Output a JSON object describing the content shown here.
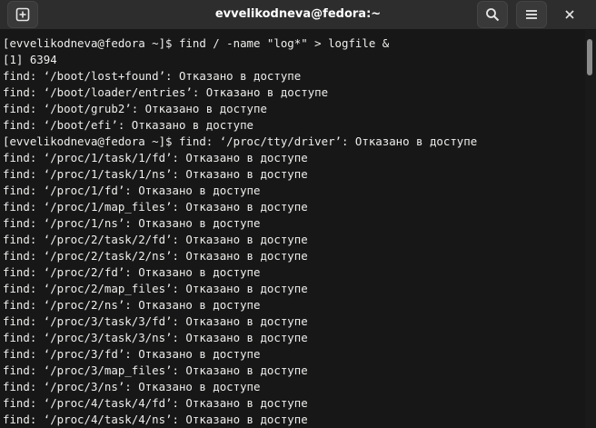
{
  "window": {
    "title": "evvelikodneva@fedora:~"
  },
  "toolbar": {
    "new_tab_icon": "new-tab-icon",
    "search_icon": "search-icon",
    "menu_icon": "hamburger-menu-icon",
    "close_icon": "close-icon"
  },
  "colors": {
    "titlebar_bg": "#2d2d2d",
    "terminal_bg": "#171717",
    "text": "#eeeeec"
  },
  "terminal": {
    "lines": [
      "[evvelikodneva@fedora ~]$ find / -name \"log*\" > logfile &",
      "[1] 6394",
      "find: ‘/boot/lost+found’: Отказано в доступе",
      "find: ‘/boot/loader/entries’: Отказано в доступе",
      "find: ‘/boot/grub2’: Отказано в доступе",
      "find: ‘/boot/efi’: Отказано в доступе",
      "[evvelikodneva@fedora ~]$ find: ‘/proc/tty/driver’: Отказано в доступе",
      "find: ‘/proc/1/task/1/fd’: Отказано в доступе",
      "find: ‘/proc/1/task/1/ns’: Отказано в доступе",
      "find: ‘/proc/1/fd’: Отказано в доступе",
      "find: ‘/proc/1/map_files’: Отказано в доступе",
      "find: ‘/proc/1/ns’: Отказано в доступе",
      "find: ‘/proc/2/task/2/fd’: Отказано в доступе",
      "find: ‘/proc/2/task/2/ns’: Отказано в доступе",
      "find: ‘/proc/2/fd’: Отказано в доступе",
      "find: ‘/proc/2/map_files’: Отказано в доступе",
      "find: ‘/proc/2/ns’: Отказано в доступе",
      "find: ‘/proc/3/task/3/fd’: Отказано в доступе",
      "find: ‘/proc/3/task/3/ns’: Отказано в доступе",
      "find: ‘/proc/3/fd’: Отказано в доступе",
      "find: ‘/proc/3/map_files’: Отказано в доступе",
      "find: ‘/proc/3/ns’: Отказано в доступе",
      "find: ‘/proc/4/task/4/fd’: Отказано в доступе",
      "find: ‘/proc/4/task/4/ns’: Отказано в доступе"
    ]
  }
}
